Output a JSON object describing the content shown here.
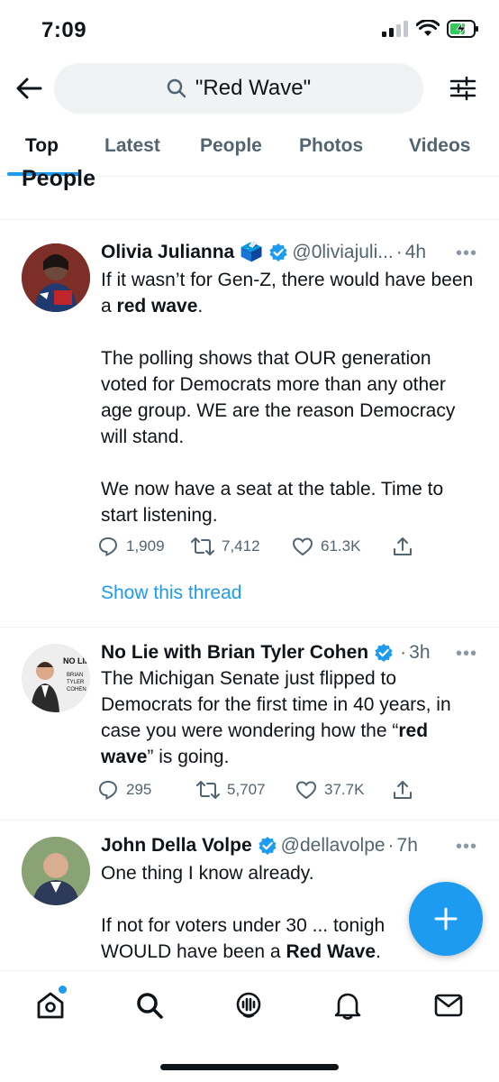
{
  "status_bar": {
    "time": "7:09"
  },
  "search": {
    "query": "\"Red Wave\""
  },
  "tabs": [
    {
      "label": "Top"
    },
    {
      "label": "Latest"
    },
    {
      "label": "People"
    },
    {
      "label": "Photos"
    },
    {
      "label": "Videos"
    }
  ],
  "section": {
    "heading": "People"
  },
  "tweets": [
    {
      "display_name": "Olivia Julianna",
      "name_emoji": "🗳️",
      "handle": "@0liviajuli...",
      "dot": "·",
      "time": "4h",
      "more": "•••",
      "body": [
        [
          "If it wasn’t for Gen-Z, there would have been a ",
          "red wave",
          "."
        ],
        [
          "The polling shows that OUR generation voted for Democrats more than any other age group. WE are the reason Democracy will stand."
        ],
        [
          "We now have a seat at the table. Time to start listening."
        ]
      ],
      "replies": "1,909",
      "retweets": "7,412",
      "likes": "61.3K",
      "show_thread": "Show this thread"
    },
    {
      "display_name": "No Lie with Brian Tyler Cohen",
      "avatar_text": "NO LIE",
      "avatar_subtext": "BRIAN TYLER COHEN",
      "dot": "·",
      "time": "3h",
      "more": "•••",
      "body": [
        [
          "The Michigan Senate just flipped to Democrats for the first time in 40 years, in case you were wondering how the “",
          "red wave",
          "” is going."
        ]
      ],
      "replies": "295",
      "retweets": "5,707",
      "likes": "37.7K"
    },
    {
      "display_name": "John Della Volpe",
      "handle": "@dellavolpe",
      "dot": "·",
      "time": "7h",
      "more": "•••",
      "body": [
        [
          "One thing I know already."
        ],
        [
          "If not for voters under 30 ... tonigh",
          "",
          ""
        ],
        [
          "WOULD have been a ",
          "Red Wave",
          "."
        ]
      ]
    }
  ],
  "icons": {
    "back": "arrow-left-icon",
    "search": "search-icon",
    "filter": "sliders-icon",
    "verified": "verified-badge-icon",
    "reply": "reply-icon",
    "retweet": "retweet-icon",
    "like": "heart-icon",
    "share": "share-icon",
    "compose": "plus-icon",
    "home": "home-icon",
    "explore": "search-icon",
    "spaces": "spaces-icon",
    "notifications": "bell-icon",
    "messages": "mail-icon"
  },
  "colors": {
    "accent": "#1d9bf0",
    "text": "#0f1419",
    "secondary": "#536471"
  }
}
